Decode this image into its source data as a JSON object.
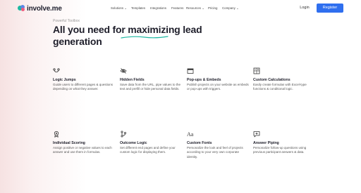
{
  "header": {
    "logo_text": "involve.me",
    "nav": [
      "Solutions ⌄",
      "Templates",
      "Integrations",
      "Features",
      "Resources ⌄",
      "Pricing",
      "Company ⌄"
    ],
    "login_label": "Login",
    "register_label": "Register",
    "accent_color": "#2f6fef"
  },
  "hero": {
    "eyebrow": "Powerful Toolbox",
    "headline_pre": "All you need for ",
    "headline_highlight": "maximizing",
    "headline_post": " lead generation"
  },
  "features": [
    {
      "icon": "logic-jumps-icon",
      "title": "Logic Jumps",
      "desc": "Guide users to different pages & questions depending on what they answer."
    },
    {
      "icon": "eye-off-icon",
      "title": "Hidden Fields",
      "desc": "Save data from the URL, pipe values to the text and prefill or hide personal data fields."
    },
    {
      "icon": "popup-window-icon",
      "title": "Pop-ups & Embeds",
      "desc": "Publish projects on your website as embeds or pop-ups with triggers."
    },
    {
      "icon": "calculator-icon",
      "title": "Custom Calculations",
      "desc": "Easily create formulas with Excel-type functions & conditional logic."
    },
    {
      "icon": "award-icon",
      "title": "Individual Scoring",
      "desc": "Assign positive or negative values to each answer and use them in formulas."
    },
    {
      "icon": "branch-icon",
      "title": "Outcome Logic",
      "desc": "Set different end pages and define your custom logic for displaying them."
    },
    {
      "icon": "font-icon",
      "title": "Custom Fonts",
      "desc": "Personalize the look and feel of projects according to your very own corporate identity."
    },
    {
      "icon": "message-plus-icon",
      "title": "Answer Piping",
      "desc": "Personalize follow-up questions using previous participant answers & data."
    }
  ]
}
